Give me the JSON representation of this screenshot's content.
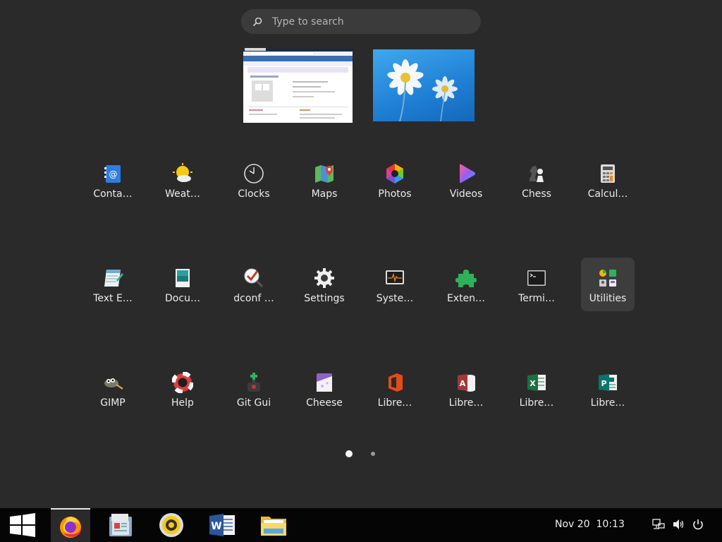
{
  "search": {
    "placeholder": "Type to search"
  },
  "windows": [
    "browser-window",
    "wallpaper-window"
  ],
  "apps": [
    {
      "label": "Conta…",
      "icon": "contacts-icon"
    },
    {
      "label": "Weat…",
      "icon": "weather-icon"
    },
    {
      "label": "Clocks",
      "icon": "clocks-icon"
    },
    {
      "label": "Maps",
      "icon": "maps-icon"
    },
    {
      "label": "Photos",
      "icon": "photos-icon"
    },
    {
      "label": "Videos",
      "icon": "videos-icon"
    },
    {
      "label": "Chess",
      "icon": "chess-icon"
    },
    {
      "label": "Calcul…",
      "icon": "calculator-icon"
    },
    {
      "label": "Text E…",
      "icon": "text-editor-icon"
    },
    {
      "label": "Docu…",
      "icon": "document-viewer-icon"
    },
    {
      "label": "dconf …",
      "icon": "dconf-editor-icon"
    },
    {
      "label": "Settings",
      "icon": "settings-icon"
    },
    {
      "label": "Syste…",
      "icon": "system-monitor-icon"
    },
    {
      "label": "Exten…",
      "icon": "extensions-icon"
    },
    {
      "label": "Termi…",
      "icon": "terminal-icon"
    },
    {
      "label": "Utilities",
      "icon": "utilities-folder-icon"
    },
    {
      "label": "GIMP",
      "icon": "gimp-icon"
    },
    {
      "label": "Help",
      "icon": "help-icon"
    },
    {
      "label": "Git Gui",
      "icon": "git-gui-icon"
    },
    {
      "label": "Cheese",
      "icon": "cheese-icon"
    },
    {
      "label": "Libre…",
      "icon": "office-icon"
    },
    {
      "label": "Libre…",
      "icon": "access-icon"
    },
    {
      "label": "Libre…",
      "icon": "excel-icon"
    },
    {
      "label": "Libre…",
      "icon": "publisher-icon"
    }
  ],
  "pager": {
    "pages": 2,
    "current": 1
  },
  "taskbar": {
    "items": [
      "start-icon",
      "firefox-icon",
      "file-manager-icon",
      "audio-player-icon",
      "word-icon",
      "folder-icon"
    ],
    "date": "Nov 20",
    "time": "10:13",
    "tray": [
      "network-icon",
      "volume-icon",
      "power-icon"
    ]
  },
  "colors": {
    "background": "#2a2a2a",
    "taskbar": "#050505",
    "highlight": "#3d3d3d"
  }
}
